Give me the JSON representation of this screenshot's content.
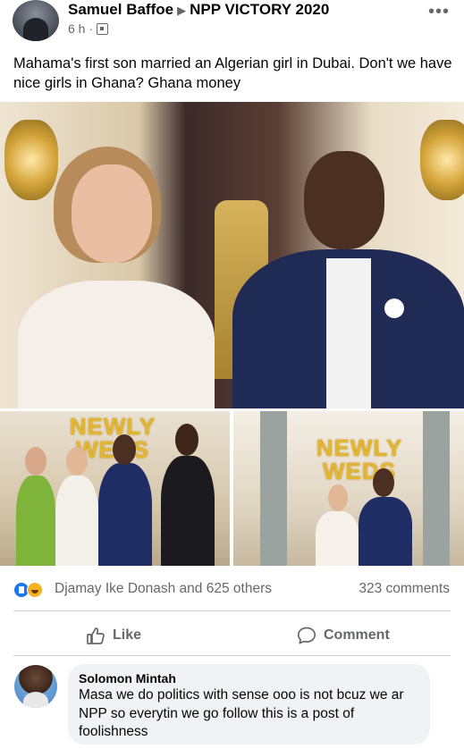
{
  "post": {
    "author": "Samuel Baffoe",
    "group": "NPP VICTORY 2020",
    "time": "6 h",
    "separator": "·",
    "more_icon": "more-options-icon",
    "text": "Mahama's first son married an Algerian girl in Dubai. Don't we have nice girls in Ghana? Ghana money"
  },
  "photos": {
    "left_balloon_text": "NEWLY WEDS",
    "right_balloon_text": "NEWLY WEDS"
  },
  "engagement": {
    "reactors": "Djamay Ike Donash and 625 others",
    "comments": "323 comments",
    "reaction_icons": [
      "like-reaction-icon",
      "haha-reaction-icon"
    ]
  },
  "actions": {
    "like_label": "Like",
    "comment_label": "Comment"
  },
  "comment": {
    "author": "Solomon Mintah",
    "text": "Masa we do politics with sense ooo is not bcuz we ar NPP so everytin we go follow this is a post of foolishness"
  },
  "colors": {
    "secondary_text": "#65676b",
    "link_blue": "#1877f2",
    "bubble_bg": "#f0f2f5",
    "balloon_gold": "#e2b532"
  }
}
